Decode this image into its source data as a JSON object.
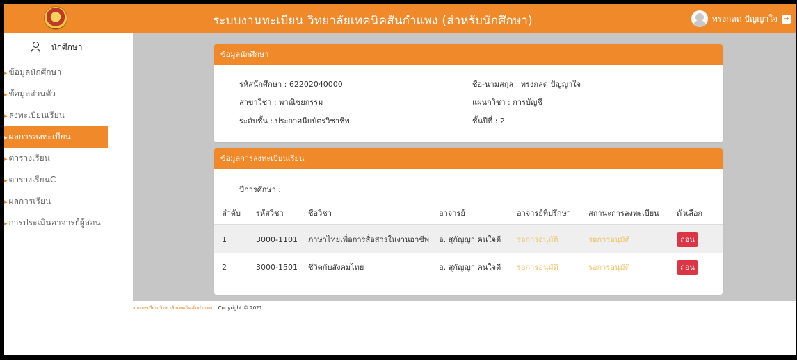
{
  "header": {
    "title": "ระบบงานทะเบียน วิทยาลัยเทคนิคสันกำแพง (สำหรับนักศึกษา)",
    "user_name": "ทรงกลด ปัญญาใจ",
    "icons": [
      "school-logo",
      "avatar",
      "logout-icon"
    ]
  },
  "sidebar": {
    "heading": "นักศึกษา",
    "items": [
      {
        "label": "ข้อมูลนักศึกษา"
      },
      {
        "label": "ข้อมูลส่วนตัว"
      },
      {
        "label": "ลงทะเบียนเรียน"
      },
      {
        "label": "ผลการลงทะเบียน"
      },
      {
        "label": "ตารางเรียน"
      },
      {
        "label": "ตารางเรียนC"
      },
      {
        "label": "ผลการเรียน"
      },
      {
        "label": "การประเมินอาจารย์ผู้สอน"
      }
    ],
    "active_index": 3
  },
  "student_panel": {
    "title": "ข้อมูลนักศึกษา",
    "student_id": "รหัสนักศึกษา : 62202040000",
    "full_name": "ชื่อ-นามสกุล : ทรงกลด ปัญญาใจ",
    "major": "สาขาวิชา : พาณิชยกรรม",
    "department": "แผนกวิชา : การบัญชี",
    "level": "ระดับชั้น : ประกาศนียบัตรวิชาชีพ",
    "year": "ชั้นปีที่ : 2"
  },
  "registration_panel": {
    "title": "ข้อมูลการลงทะเบียนเรียน",
    "academic_year": "ปีการศึกษา :",
    "columns": [
      "ลำดับ",
      "รหัสวิชา",
      "ชื่อวิชา",
      "อาจารย์",
      "อาจารย์ที่ปรึกษา",
      "สถานะการลงทะเบียน",
      "ตัวเลือก"
    ],
    "rows": [
      {
        "no": "1",
        "code": "3000-1101",
        "name": "ภาษาไทยเพื่อการสื่อสารในงานอาชีพ",
        "teacher": "อ. สุกัญญา คนใจดี",
        "advisor_status": "รอการอนุมัติ",
        "reg_status": "รอการอนุมัติ",
        "action": "ถอน"
      },
      {
        "no": "2",
        "code": "3000-1501",
        "name": "ชีวิตกับสังคมไทย",
        "teacher": "อ. สุกัญญา คนใจดี",
        "advisor_status": "รอการอนุมัติ",
        "reg_status": "รอการอนุมัติ",
        "action": "ถอน"
      }
    ]
  },
  "footer": {
    "school": "งานทะเบียน วิทยาลัยเทคนิคสันกำแพง",
    "copyright": "Copyright © 2021"
  },
  "colors": {
    "accent": "#f0892a",
    "content_bg": "#c6c6c6",
    "pending": "#f0c36a",
    "danger": "#dc3545"
  }
}
